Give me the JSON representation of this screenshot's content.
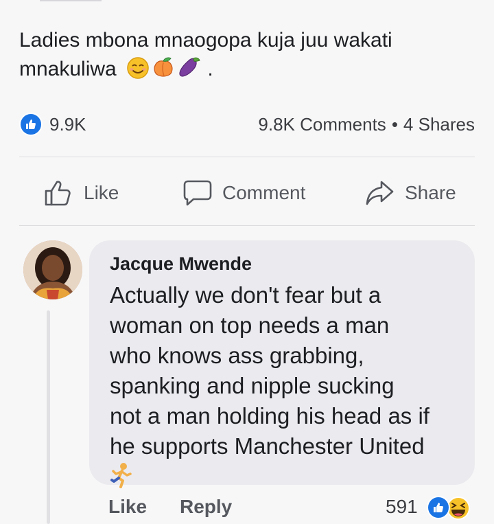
{
  "post": {
    "text_line1": "Ladies mbona mnaogopa kuja juu wakati",
    "text_line2": "mnakuliwa",
    "text_tail": ".",
    "emojis": [
      "smiling-face-icon",
      "peach-icon",
      "eggplant-icon"
    ]
  },
  "stats": {
    "reaction_count": "9.9K",
    "comments": "9.8K Comments",
    "separator": "•",
    "shares": "4 Shares"
  },
  "actions": {
    "like": "Like",
    "comment": "Comment",
    "share": "Share"
  },
  "comment": {
    "author": "Jacque Mwende",
    "text": "Actually we don't fear but a\nwoman on top needs a man\nwho knows ass grabbing,\nspanking and nipple sucking\nnot a man holding his head as if\nhe supports Manchester United",
    "emoji": "running-person-icon",
    "like_label": "Like",
    "reply_label": "Reply",
    "reaction_count": "591",
    "reactions": [
      "like-icon",
      "haha-icon"
    ]
  },
  "colors": {
    "accent": "#1b74e4",
    "bubble": "#ebebef",
    "background": "#f7f7f8",
    "secondary_text": "#55585e"
  }
}
